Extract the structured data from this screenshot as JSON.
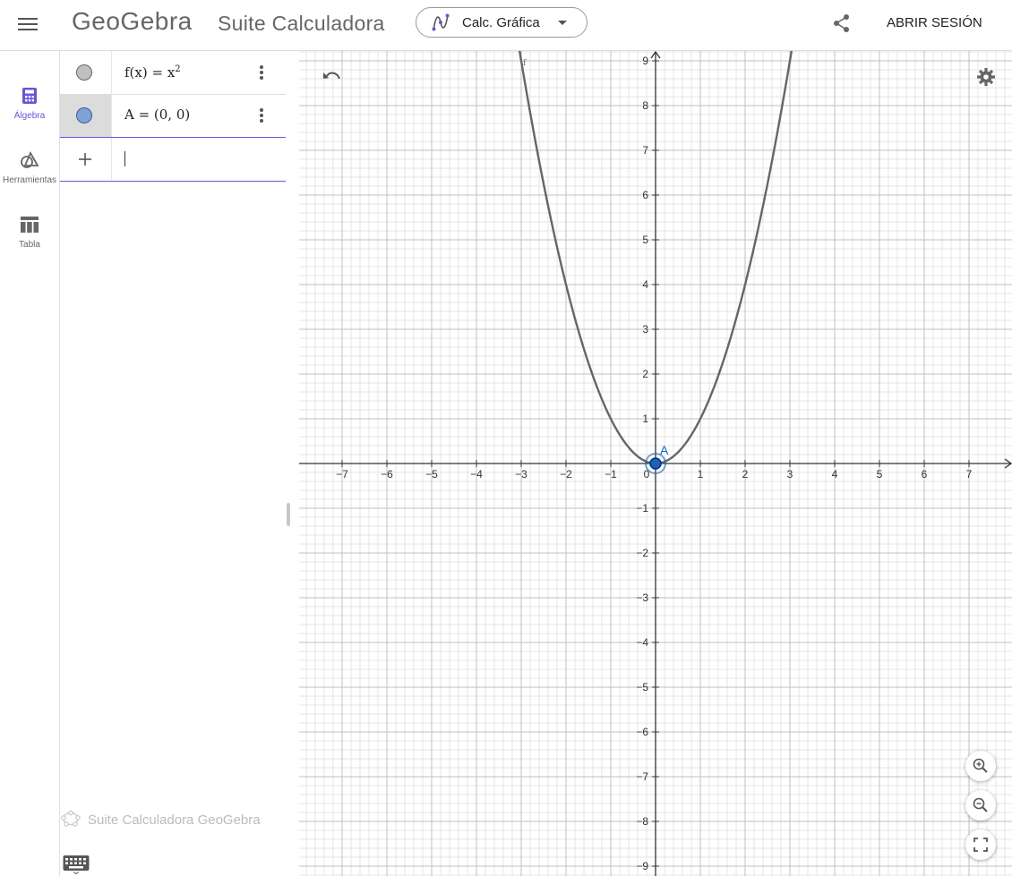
{
  "header": {
    "logo_text": "GeoGebra",
    "title": "Suite Calculadora",
    "app_switcher": {
      "label": "Calc. Gráfica",
      "icon": "graphing-icon"
    },
    "share_icon": "share-icon",
    "login_label": "ABRIR SESIÓN"
  },
  "sidebar": {
    "items": [
      {
        "label": "Álgebra",
        "icon": "calculator-icon",
        "active": true
      },
      {
        "label": "Herramientas",
        "icon": "tools-icon",
        "active": false
      },
      {
        "label": "Tabla",
        "icon": "table-icon",
        "active": false
      }
    ]
  },
  "algebra": {
    "rows": [
      {
        "lhs": "f(x) = x",
        "sup": "2",
        "marble_color": "#c0c0c0"
      },
      {
        "lhs": "A = (0, 0)",
        "sup": "",
        "marble_color": "#7ea3d6"
      }
    ],
    "input_placeholder": ""
  },
  "footer": {
    "brand": "Suite Calculadora GeoGebra"
  },
  "graphics": {
    "x_range": [
      -7,
      7
    ],
    "y_range": [
      -9,
      9
    ],
    "x_tick_labels": [
      "−7",
      "−6",
      "−5",
      "−4",
      "−3",
      "−2",
      "−1",
      "0",
      "1",
      "2",
      "3",
      "4",
      "5",
      "6",
      "7"
    ],
    "y_tick_labels": [
      "9",
      "8",
      "7",
      "6",
      "5",
      "4",
      "3",
      "2",
      "1",
      "−1",
      "−2",
      "−3",
      "−4",
      "−5",
      "−6",
      "−7",
      "−8",
      "−9"
    ],
    "function": {
      "name": "f",
      "expression": "x^2",
      "color": "#666666"
    },
    "point": {
      "name": "A",
      "x": 0,
      "y": 0,
      "color": "#1565c0"
    },
    "buttons": {
      "undo_icon": "undo-icon",
      "settings_icon": "gear-icon",
      "zoom_in_icon": "zoom-in-icon",
      "zoom_out_icon": "zoom-out-icon",
      "fullscreen_icon": "fullscreen-icon"
    }
  },
  "colors": {
    "accent": "#6557d2",
    "grid_major": "#c0c0c0",
    "grid_minor": "#e4e4e4"
  }
}
